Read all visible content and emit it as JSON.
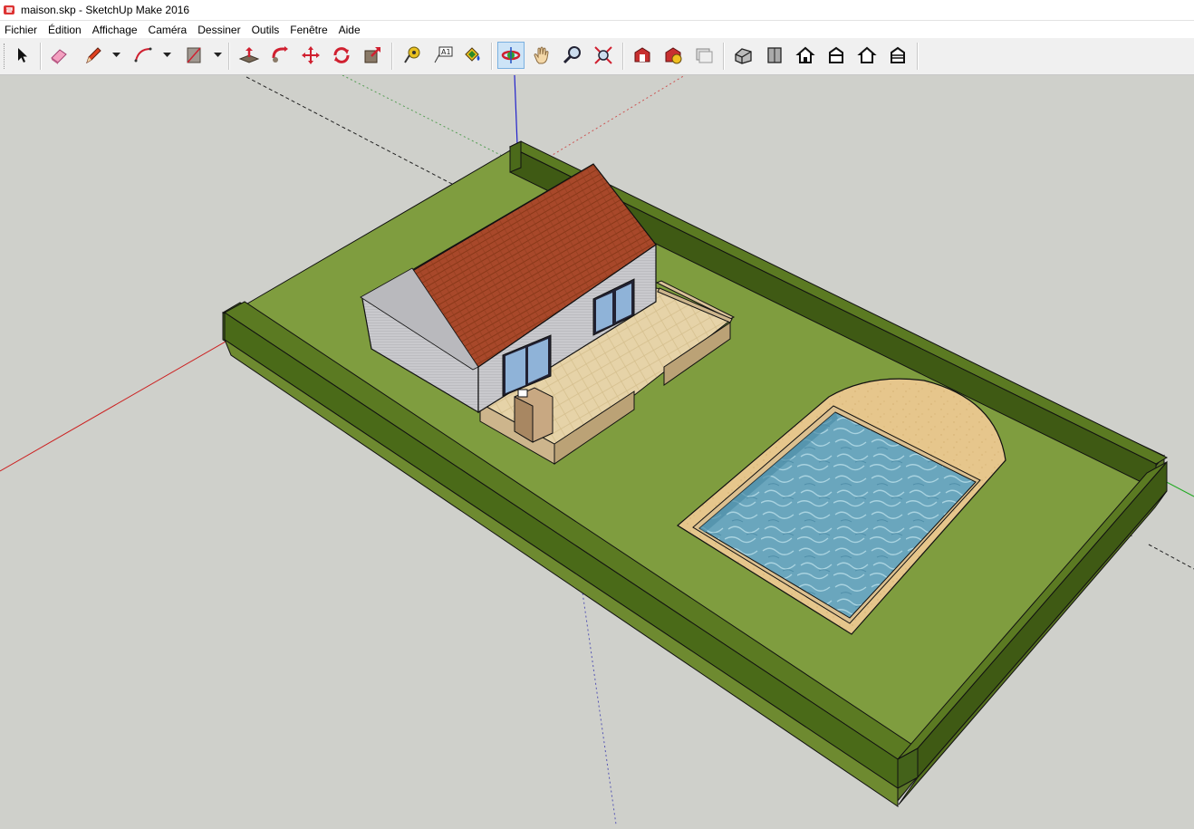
{
  "window": {
    "title": "maison.skp - SketchUp Make 2016"
  },
  "menu": [
    "Fichier",
    "Édition",
    "Affichage",
    "Caméra",
    "Dessiner",
    "Outils",
    "Fenêtre",
    "Aide"
  ],
  "toolbar": {
    "tools": [
      "select-tool",
      "eraser-tool",
      "pencil-line-tool",
      "arc-tool",
      "rectangle-tool",
      "push-pull-tool",
      "follow-me-tool",
      "move-tool",
      "rotate-tool",
      "scale-tool",
      "tape-measure-tool",
      "text-tool",
      "paint-bucket-tool",
      "orbit-tool",
      "pan-tool",
      "zoom-tool",
      "zoom-extents-tool",
      "3d-warehouse-tool",
      "extension-warehouse-tool",
      "layout-tool",
      "iso-view",
      "top-view",
      "front-view",
      "right-view",
      "back-view",
      "left-view"
    ],
    "active_tool": "orbit-tool"
  },
  "colors": {
    "viewport_bg": "#cfd0cb",
    "grass": "#84a04a",
    "hedge": "#4e6e1c",
    "roof": "#b04a25",
    "pool": "#6fa9c0",
    "sand": "#e4c48a"
  }
}
